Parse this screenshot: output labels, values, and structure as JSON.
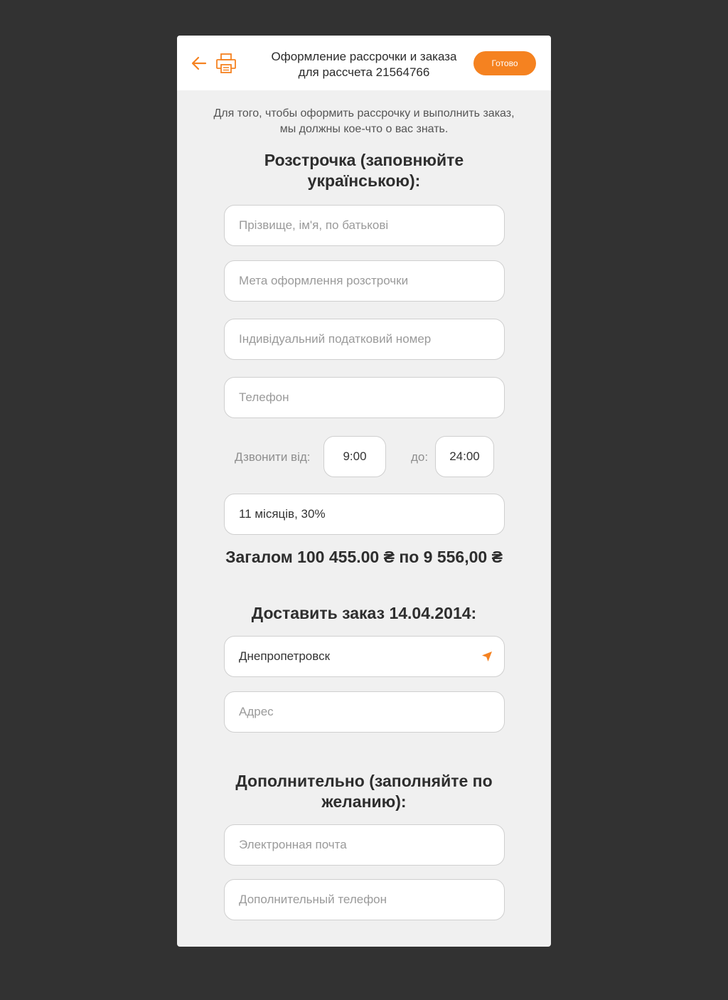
{
  "header": {
    "title": "Оформление рассрочки и заказа для рассчета 21564766",
    "done_label": "Готово"
  },
  "intro_text": "Для того, чтобы оформить рассрочку и выполнить заказ, мы должны кое-что о вас знать.",
  "installment": {
    "title": "Розстрочка (заповнюйте українською):",
    "full_name_placeholder": "Прізвище, ім'я, по батькові",
    "purpose_placeholder": "Мета оформлення розстрочки",
    "tax_id_placeholder": "Індивідуальний податковий номер",
    "phone_placeholder": "Телефон",
    "call_from_label": "Дзвонити від:",
    "call_from_value": "9:00",
    "call_to_label": "до:",
    "call_to_value": "24:00",
    "plan_value": "11 місяців, 30%",
    "total_text": "Загалом 100 455.00 ₴ по 9 556,00 ₴"
  },
  "delivery": {
    "title": "Доставить заказ 14.04.2014:",
    "city_value": "Днепропетровск",
    "address_placeholder": "Адрес"
  },
  "additional": {
    "title": "Дополнительно (заполняйте по желанию):",
    "email_placeholder": "Электронная почта",
    "extra_phone_placeholder": "Дополнительный телефон"
  },
  "colors": {
    "accent": "#f58220",
    "backdrop": "#323232",
    "card": "#f0f0f0"
  },
  "icons": {
    "back": "arrow-left-icon",
    "print": "printer-icon",
    "location": "location-arrow-icon"
  }
}
